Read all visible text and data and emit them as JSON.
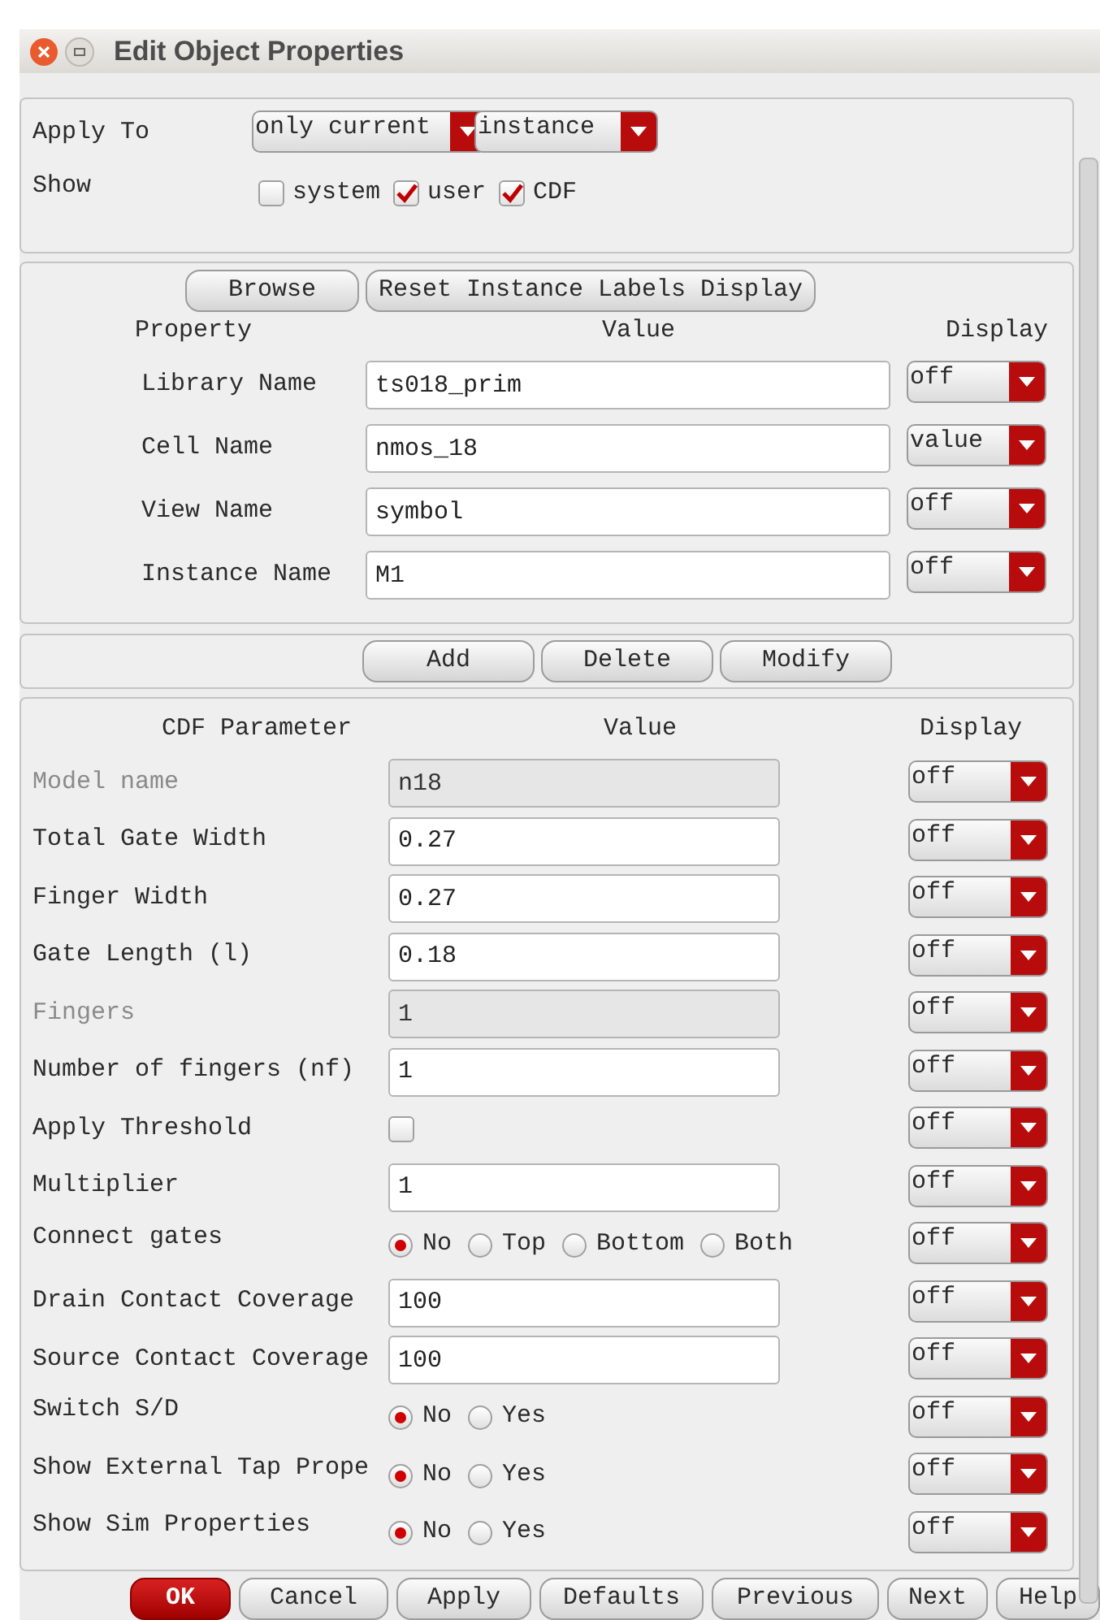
{
  "window": {
    "title": "Edit Object Properties"
  },
  "apply_to": {
    "label": "Apply To",
    "scope": "only current",
    "target": "instance"
  },
  "show": {
    "label": "Show",
    "options": [
      {
        "label": "system",
        "checked": false
      },
      {
        "label": "user",
        "checked": true
      },
      {
        "label": "CDF",
        "checked": true
      }
    ]
  },
  "property_section": {
    "buttons": [
      "Browse",
      "Reset Instance Labels Display"
    ],
    "columns": [
      "Property",
      "Value",
      "Display"
    ],
    "rows": [
      {
        "label": "Library Name",
        "value": "ts018_prim",
        "display": "off"
      },
      {
        "label": "Cell Name",
        "value": "nmos_18",
        "display": "value"
      },
      {
        "label": "View Name",
        "value": "symbol",
        "display": "off"
      },
      {
        "label": "Instance Name",
        "value": "M1",
        "display": "off"
      }
    ]
  },
  "property_buttons": [
    "Add",
    "Delete",
    "Modify"
  ],
  "cdf_section": {
    "columns": [
      "CDF Parameter",
      "Value",
      "Display"
    ],
    "rows": [
      {
        "kind": "field",
        "label": "Model name",
        "value": "n18",
        "disabled": true,
        "display": "off"
      },
      {
        "kind": "field",
        "label": "Total Gate Width",
        "value": "0.27",
        "disabled": false,
        "display": "off"
      },
      {
        "kind": "field",
        "label": "Finger Width",
        "value": "0.27",
        "disabled": false,
        "display": "off"
      },
      {
        "kind": "field",
        "label": "Gate Length (l)",
        "value": "0.18",
        "disabled": false,
        "display": "off"
      },
      {
        "kind": "field",
        "label": "Fingers",
        "value": "1",
        "disabled": true,
        "display": "off"
      },
      {
        "kind": "field",
        "label": "Number of fingers (nf)",
        "value": "1",
        "disabled": false,
        "display": "off"
      },
      {
        "kind": "checkbox",
        "label": "Apply Threshold",
        "checked": false,
        "display": "off"
      },
      {
        "kind": "field",
        "label": "Multiplier",
        "value": "1",
        "disabled": false,
        "display": "off"
      },
      {
        "kind": "radio",
        "label": "Connect gates",
        "options": [
          {
            "label": "No",
            "selected": true
          },
          {
            "label": "Top",
            "selected": false
          },
          {
            "label": "Bottom",
            "selected": false
          },
          {
            "label": "Both",
            "selected": false
          }
        ],
        "display": "off"
      },
      {
        "kind": "field",
        "label": "Drain Contact Coverage",
        "value": "100",
        "disabled": false,
        "display": "off"
      },
      {
        "kind": "field",
        "label": "Source Contact Coverage",
        "value": "100",
        "disabled": false,
        "display": "off"
      },
      {
        "kind": "radio",
        "label": "Switch S/D",
        "options": [
          {
            "label": "No",
            "selected": true
          },
          {
            "label": "Yes",
            "selected": false
          }
        ],
        "display": "off"
      },
      {
        "kind": "radio",
        "label": "Show External Tap Prope",
        "options": [
          {
            "label": "No",
            "selected": true
          },
          {
            "label": "Yes",
            "selected": false
          }
        ],
        "display": "off"
      },
      {
        "kind": "radio",
        "label": "Show Sim Properties",
        "options": [
          {
            "label": "No",
            "selected": true
          },
          {
            "label": "Yes",
            "selected": false
          }
        ],
        "display": "off"
      }
    ]
  },
  "footer_buttons": [
    {
      "label": "OK",
      "primary": true
    },
    {
      "label": "Cancel",
      "primary": false
    },
    {
      "label": "Apply",
      "primary": false
    },
    {
      "label": "Defaults",
      "primary": false
    },
    {
      "label": "Previous",
      "primary": false
    },
    {
      "label": "Next",
      "primary": false
    },
    {
      "label": "Help",
      "primary": false
    }
  ]
}
